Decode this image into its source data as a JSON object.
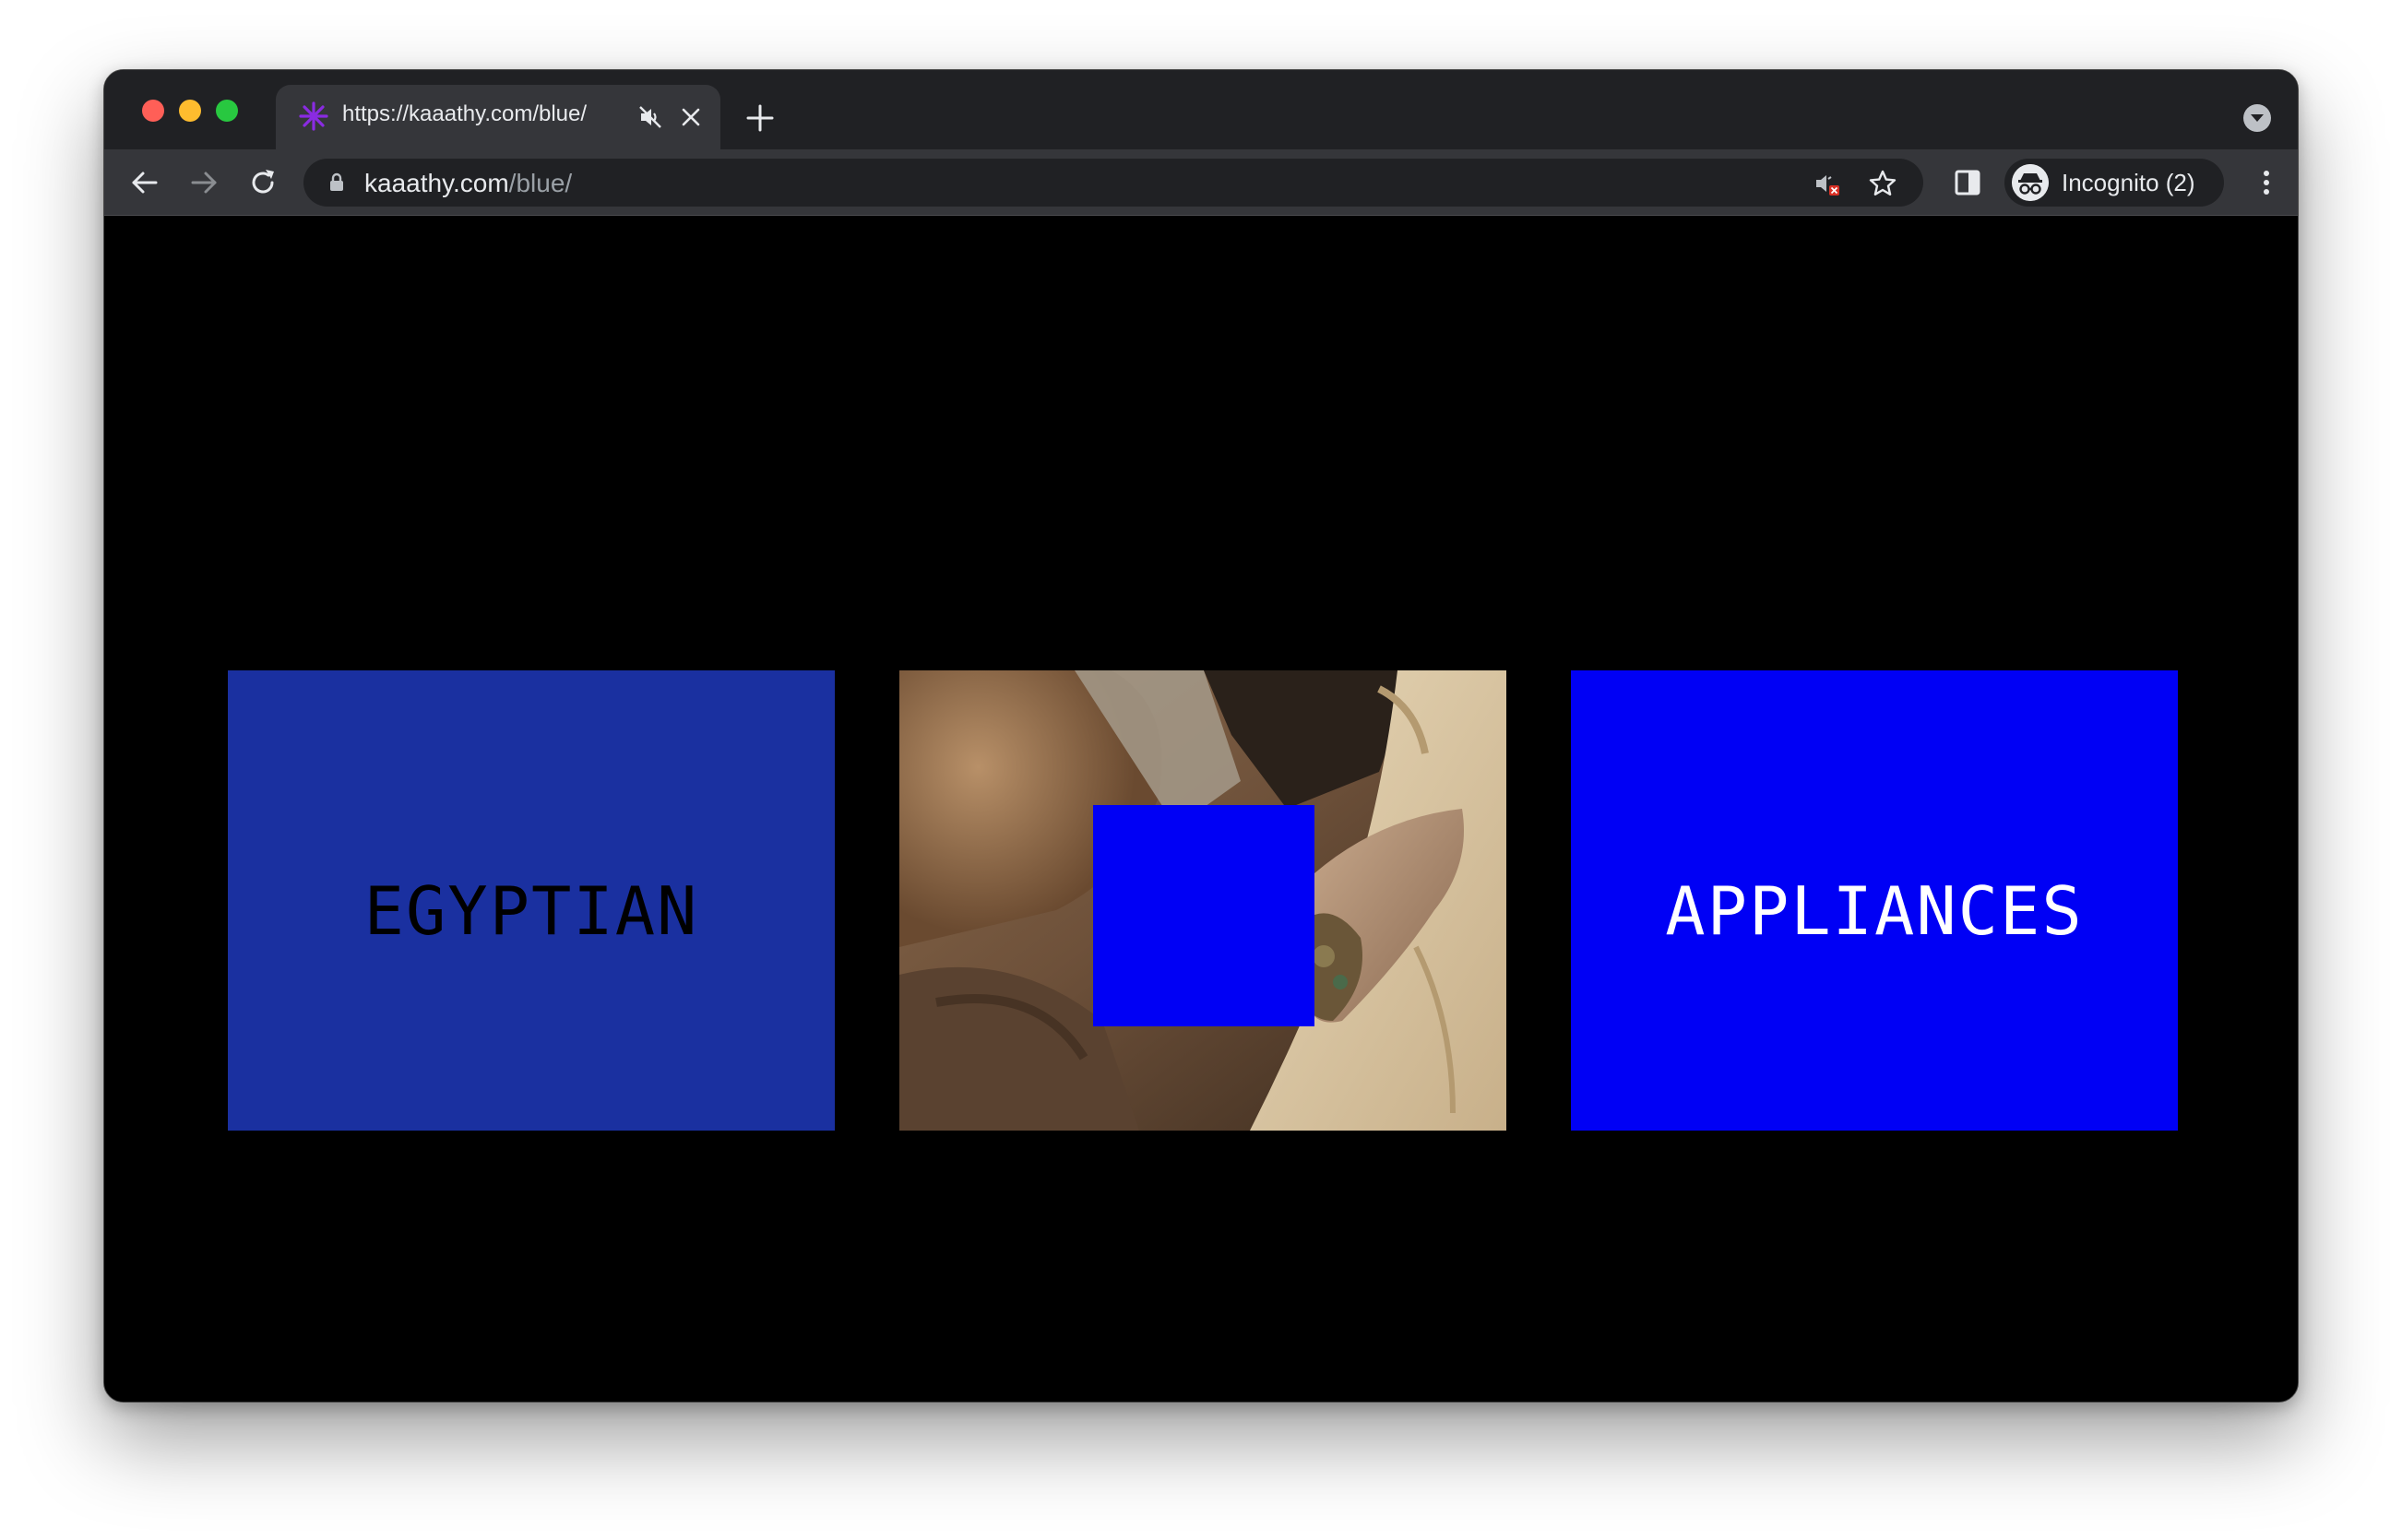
{
  "window": {
    "controls": [
      "close",
      "minimize",
      "zoom"
    ]
  },
  "tab": {
    "favicon": "asterisk-icon",
    "title": "https://kaaathy.com/blue/",
    "muted_icon": "speaker-muted-icon",
    "close_icon": "close-icon"
  },
  "toolbar": {
    "back_icon": "arrow-left-icon",
    "forward_icon": "arrow-right-icon",
    "reload_icon": "reload-icon",
    "url_host": "kaaathy.com",
    "url_path": "/blue/",
    "lock_icon": "lock-icon",
    "site_muted_icon": "site-muted-icon",
    "bookmark_icon": "star-icon",
    "side_panel_icon": "side-panel-icon",
    "profile_label": "Incognito (2)",
    "menu_icon": "kebab-menu-icon"
  },
  "content": {
    "cards": [
      {
        "label": "EGYPTIAN",
        "bg": "#1a30a0",
        "text_color": "#000000"
      },
      {
        "label": "",
        "kind": "photo",
        "overlay_color": "#0000f5"
      },
      {
        "label": "APPLIANCES",
        "bg": "#0000f5",
        "text_color": "#ffffff"
      }
    ]
  },
  "colors": {
    "page_bg": "#000000",
    "chrome_dark": "#202124",
    "chrome_tab": "#35363a",
    "favicon_purple": "#8a2be2"
  }
}
